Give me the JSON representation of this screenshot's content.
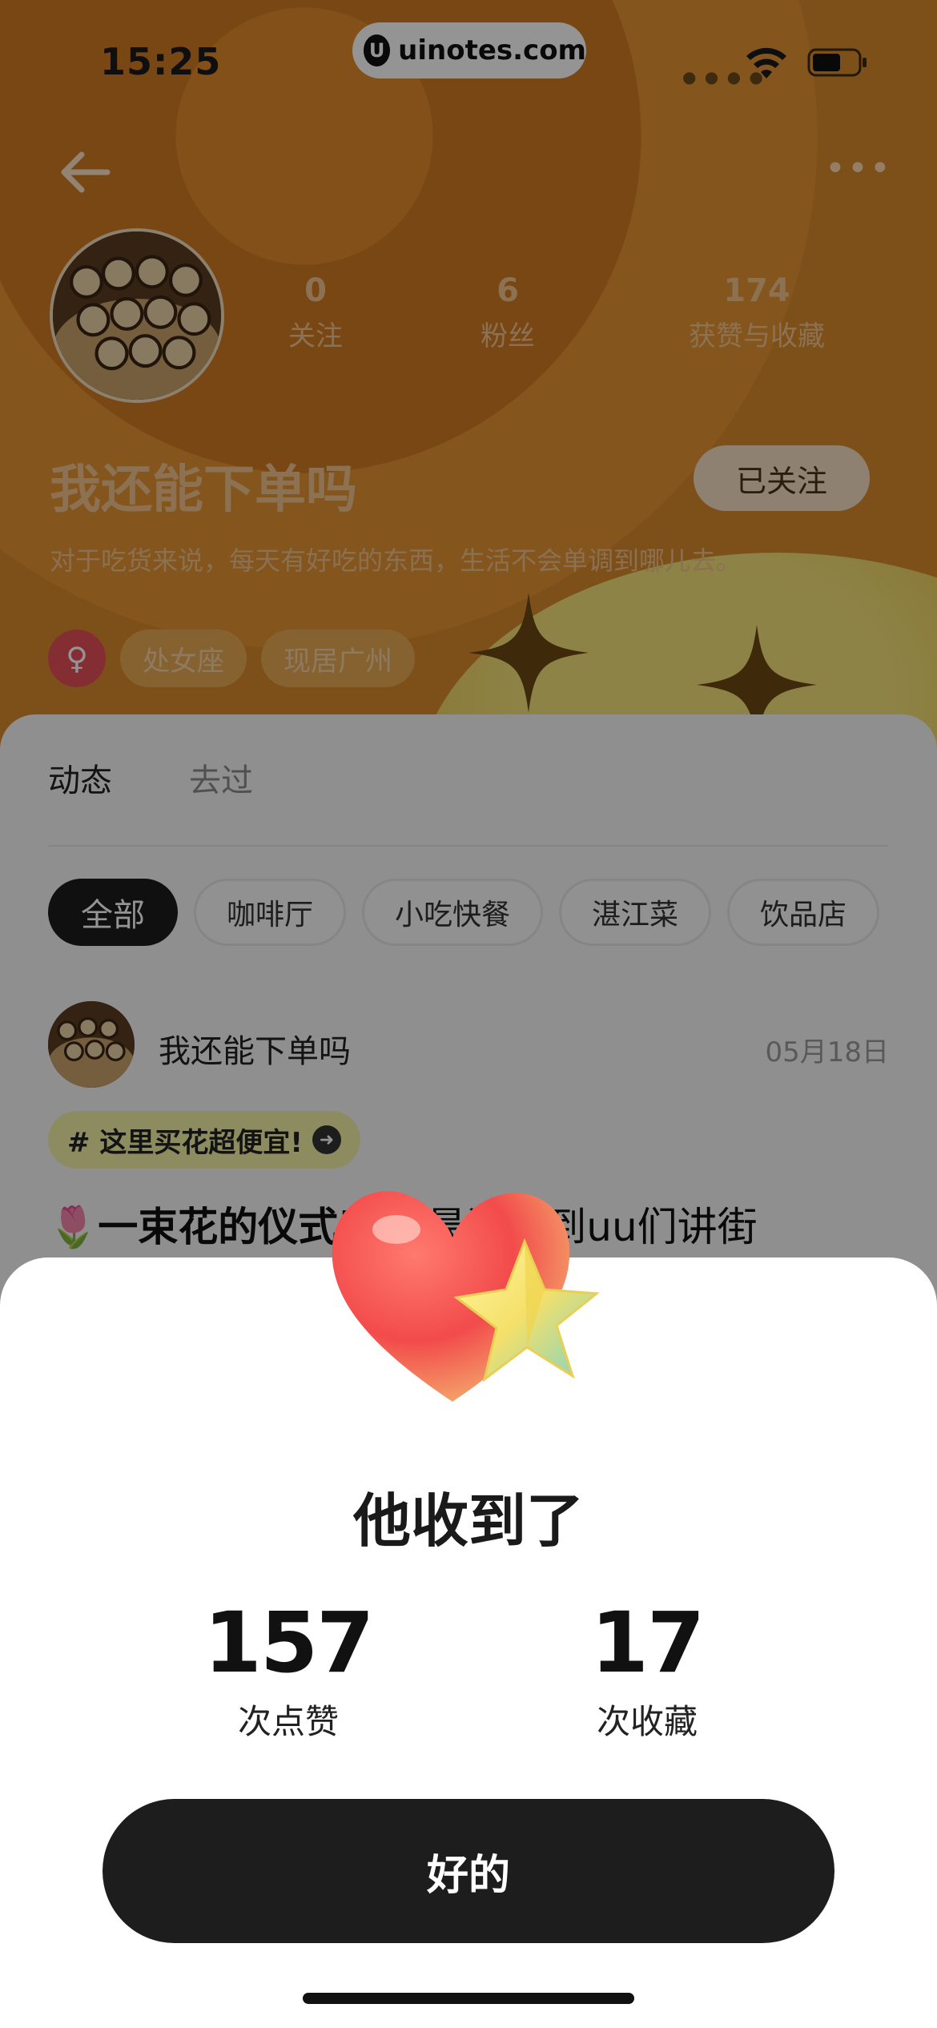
{
  "status_bar": {
    "time": "15:25",
    "watermark": "uinotes.com",
    "watermark_logo": "U"
  },
  "profile": {
    "stats": [
      {
        "value": "0",
        "label": "关注"
      },
      {
        "value": "6",
        "label": "粉丝"
      },
      {
        "value": "174",
        "label": "获赞与收藏"
      }
    ],
    "nickname": "我还能下单吗",
    "follow_button": "已关注",
    "bio": "对于吃货来说，每天有好吃的东西，生活不会单调到哪儿去。",
    "gender_symbol": "♀",
    "tags": [
      "处女座",
      "现居广州"
    ]
  },
  "content": {
    "tabs": [
      "动态",
      "去过"
    ],
    "filters": [
      "全部",
      "咖啡厅",
      "小吃快餐",
      "湛江菜",
      "饮品店"
    ],
    "post": {
      "author": "我还能下单吗",
      "date": "05月18日",
      "topic": "# 这里买花超便宜!",
      "topic_arrow": "➜",
      "title_emoji": "🌷",
      "title_lead": "一束花的仪式感",
      "title_rest": "最近看到uu们讲街"
    }
  },
  "sheet": {
    "title": "他收到了",
    "metrics": [
      {
        "value": "157",
        "label": "次点赞"
      },
      {
        "value": "17",
        "label": "次收藏"
      }
    ],
    "ok_button": "好的"
  },
  "icons": {
    "back": "back-arrow-icon",
    "more": "more-dots-icon",
    "wifi": "wifi-icon",
    "battery": "battery-icon",
    "heart_star": "heart-star-illustration"
  },
  "colors": {
    "accent_dark": "#1d1d1d",
    "hero_orange": "#d98a2c",
    "gender_pink": "#e3505a",
    "topic_yellow": "#f3f0a6"
  }
}
